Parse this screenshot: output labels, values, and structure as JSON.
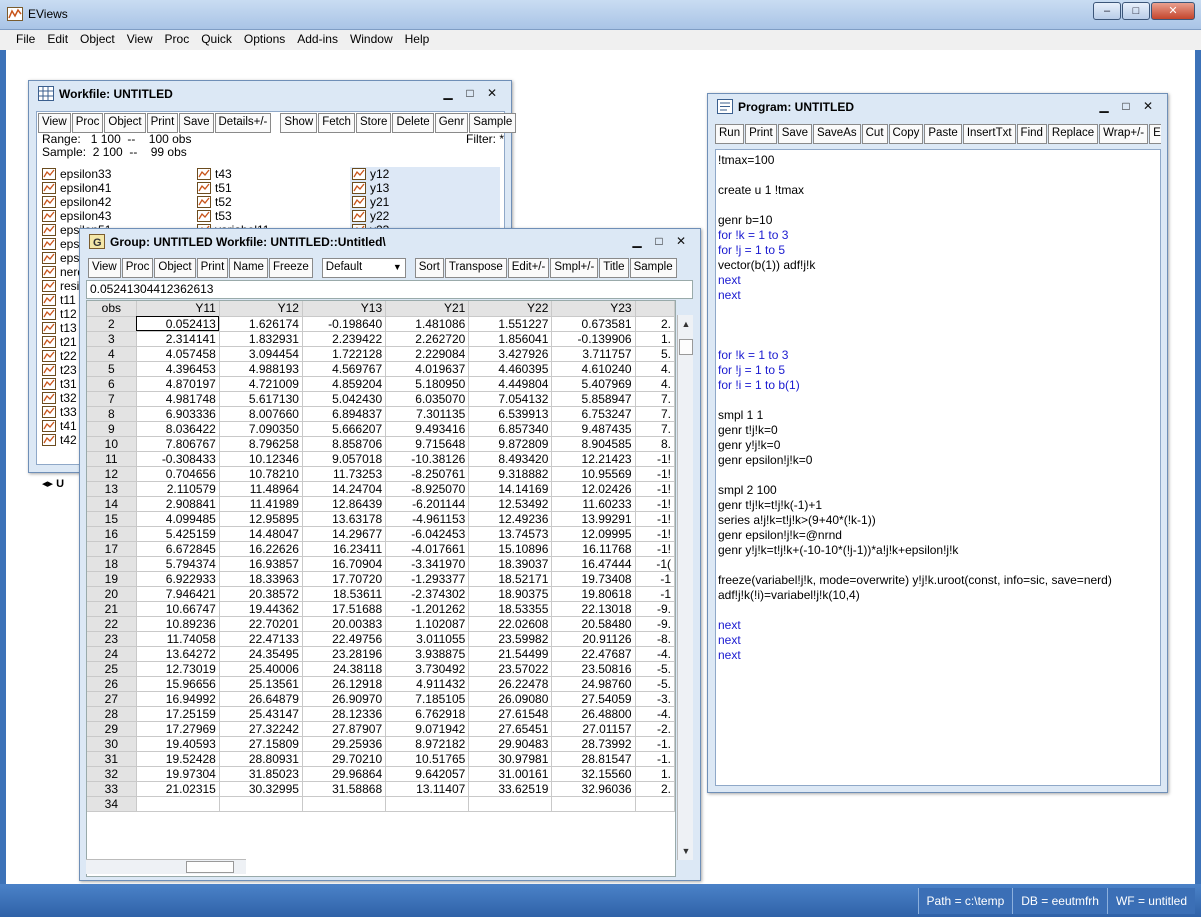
{
  "app": {
    "title": "EViews",
    "menu": [
      "File",
      "Edit",
      "Object",
      "View",
      "Proc",
      "Quick",
      "Options",
      "Add-ins",
      "Window",
      "Help"
    ],
    "status": [
      "Path = c:\\temp",
      "DB = eeutmfrh",
      "WF = untitled"
    ]
  },
  "colors": {
    "accent": "#3c72b8",
    "keyword": "#1a1ad0",
    "selection": "#dde8f6"
  },
  "workfile": {
    "title": "Workfile: UNTITLED",
    "toolbar": [
      "View",
      "Proc",
      "Object",
      "Print",
      "Save",
      "Details+/-",
      "Show",
      "Fetch",
      "Store",
      "Delete",
      "Genr",
      "Sample"
    ],
    "range_label": "Range:",
    "range_value": "1 100",
    "range_sep": "--",
    "range_obs": "100 obs",
    "sample_label": "Sample:",
    "sample_value": "2 100",
    "sample_sep": "--",
    "sample_obs": "99 obs",
    "filter": "Filter: *",
    "col1": [
      "epsilon33",
      "epsilon41",
      "epsilon42",
      "epsilon43",
      "epsilon51",
      "eps",
      "eps",
      "nerd",
      "resi",
      "t11",
      "t12",
      "t13",
      "t21",
      "t22",
      "t23",
      "t31",
      "t32",
      "t33",
      "t41",
      "t42"
    ],
    "col2": [
      "t43",
      "t51",
      "t52",
      "t53",
      "variabel11"
    ],
    "col3": [
      "y12",
      "y13",
      "y21",
      "y22",
      "y23"
    ],
    "tab": "U"
  },
  "group": {
    "title": "Group: UNTITLED   Workfile: UNTITLED::Untitled\\",
    "toolbar": [
      "View",
      "Proc",
      "Object",
      "Print",
      "Name",
      "Freeze"
    ],
    "dropdown_value": "Default",
    "toolbar2": [
      "Sort",
      "Transpose",
      "Edit+/-",
      "Smpl+/-",
      "Title",
      "Sample"
    ],
    "edit_value": "0.05241304412362613",
    "headers": [
      "obs",
      "Y11",
      "Y12",
      "Y13",
      "Y21",
      "Y22",
      "Y23",
      ""
    ],
    "rows": [
      [
        "2",
        "0.052413",
        "1.626174",
        "-0.198640",
        "1.481086",
        "1.551227",
        "0.673581",
        "2."
      ],
      [
        "3",
        "2.314141",
        "1.832931",
        "2.239422",
        "2.262720",
        "1.856041",
        "-0.139906",
        "1."
      ],
      [
        "4",
        "4.057458",
        "3.094454",
        "1.722128",
        "2.229084",
        "3.427926",
        "3.711757",
        "5."
      ],
      [
        "5",
        "4.396453",
        "4.988193",
        "4.569767",
        "4.019637",
        "4.460395",
        "4.610240",
        "4."
      ],
      [
        "6",
        "4.870197",
        "4.721009",
        "4.859204",
        "5.180950",
        "4.449804",
        "5.407969",
        "4."
      ],
      [
        "7",
        "4.981748",
        "5.617130",
        "5.042430",
        "6.035070",
        "7.054132",
        "5.858947",
        "7."
      ],
      [
        "8",
        "6.903336",
        "8.007660",
        "6.894837",
        "7.301135",
        "6.539913",
        "6.753247",
        "7."
      ],
      [
        "9",
        "8.036422",
        "7.090350",
        "5.666207",
        "9.493416",
        "6.857340",
        "9.487435",
        "7."
      ],
      [
        "10",
        "7.806767",
        "8.796258",
        "8.858706",
        "9.715648",
        "9.872809",
        "8.904585",
        "8."
      ],
      [
        "11",
        "-0.308433",
        "10.12346",
        "9.057018",
        "-10.38126",
        "8.493420",
        "12.21423",
        "-1!"
      ],
      [
        "12",
        "0.704656",
        "10.78210",
        "11.73253",
        "-8.250761",
        "9.318882",
        "10.95569",
        "-1!"
      ],
      [
        "13",
        "2.110579",
        "11.48964",
        "14.24704",
        "-8.925070",
        "14.14169",
        "12.02426",
        "-1!"
      ],
      [
        "14",
        "2.908841",
        "11.41989",
        "12.86439",
        "-6.201144",
        "12.53492",
        "11.60233",
        "-1!"
      ],
      [
        "15",
        "4.099485",
        "12.95895",
        "13.63178",
        "-4.961153",
        "12.49236",
        "13.99291",
        "-1!"
      ],
      [
        "16",
        "5.425159",
        "14.48047",
        "14.29677",
        "-6.042453",
        "13.74573",
        "12.09995",
        "-1!"
      ],
      [
        "17",
        "6.672845",
        "16.22626",
        "16.23411",
        "-4.017661",
        "15.10896",
        "16.11768",
        "-1!"
      ],
      [
        "18",
        "5.794374",
        "16.93857",
        "16.70904",
        "-3.341970",
        "18.39037",
        "16.47444",
        "-1("
      ],
      [
        "19",
        "6.922933",
        "18.33963",
        "17.70720",
        "-1.293377",
        "18.52171",
        "19.73408",
        "-1"
      ],
      [
        "20",
        "7.946421",
        "20.38572",
        "18.53611",
        "-2.374302",
        "18.90375",
        "19.80618",
        "-1"
      ],
      [
        "21",
        "10.66747",
        "19.44362",
        "17.51688",
        "-1.201262",
        "18.53355",
        "22.13018",
        "-9."
      ],
      [
        "22",
        "10.89236",
        "22.70201",
        "20.00383",
        "1.102087",
        "22.02608",
        "20.58480",
        "-9."
      ],
      [
        "23",
        "11.74058",
        "22.47133",
        "22.49756",
        "3.011055",
        "23.59982",
        "20.91126",
        "-8."
      ],
      [
        "24",
        "13.64272",
        "24.35495",
        "23.28196",
        "3.938875",
        "21.54499",
        "22.47687",
        "-4."
      ],
      [
        "25",
        "12.73019",
        "25.40006",
        "24.38118",
        "3.730492",
        "23.57022",
        "23.50816",
        "-5."
      ],
      [
        "26",
        "15.96656",
        "25.13561",
        "26.12918",
        "4.911432",
        "26.22478",
        "24.98760",
        "-5."
      ],
      [
        "27",
        "16.94992",
        "26.64879",
        "26.90970",
        "7.185105",
        "26.09080",
        "27.54059",
        "-3."
      ],
      [
        "28",
        "17.25159",
        "25.43147",
        "28.12336",
        "6.762918",
        "27.61548",
        "26.48800",
        "-4."
      ],
      [
        "29",
        "17.27969",
        "27.32242",
        "27.87907",
        "9.071942",
        "27.65451",
        "27.01157",
        "-2."
      ],
      [
        "30",
        "19.40593",
        "27.15809",
        "29.25936",
        "8.972182",
        "29.90483",
        "28.73992",
        "-1."
      ],
      [
        "31",
        "19.52428",
        "28.80931",
        "29.70210",
        "10.51765",
        "30.97981",
        "28.81547",
        "-1."
      ],
      [
        "32",
        "19.97304",
        "31.85023",
        "29.96864",
        "9.642057",
        "31.00161",
        "32.15560",
        "1."
      ],
      [
        "33",
        "21.02315",
        "30.32995",
        "31.58868",
        "13.11407",
        "33.62519",
        "32.96036",
        "2."
      ],
      [
        "34",
        "",
        "",
        "",
        "",
        "",
        "",
        ""
      ]
    ]
  },
  "program": {
    "title": "Program: UNTITLED",
    "toolbar": [
      "Run",
      "Print",
      "Save",
      "SaveAs",
      "Cut",
      "Copy",
      "Paste",
      "InsertTxt",
      "Find",
      "Replace",
      "Wrap+/-",
      "Encr"
    ],
    "lines": [
      "!tmax=100",
      "",
      "create u 1 !tmax",
      "",
      "genr b=10",
      "for !k = 1 to 3",
      "for !j = 1 to 5",
      "vector(b(1)) adf!j!k",
      "next",
      "next",
      "",
      "",
      "",
      "for !k = 1 to 3",
      "for !j = 1 to 5",
      "for !i = 1 to b(1)",
      "",
      "smpl 1 1",
      "genr t!j!k=0",
      "genr y!j!k=0",
      "genr epsilon!j!k=0",
      "",
      "smpl 2 100",
      "genr t!j!k=t!j!k(-1)+1",
      "series a!j!k=t!j!k>(9+40*(!k-1))",
      "genr epsilon!j!k=@nrnd",
      "genr y!j!k=t!j!k+(-10-10*(!j-1))*a!j!k+epsilon!j!k",
      "",
      "freeze(variabel!j!k, mode=overwrite) y!j!k.uroot(const, info=sic, save=nerd)",
      "adf!j!k(!i)=variabel!j!k(10,4)",
      "",
      "next",
      "next",
      "next"
    ]
  }
}
